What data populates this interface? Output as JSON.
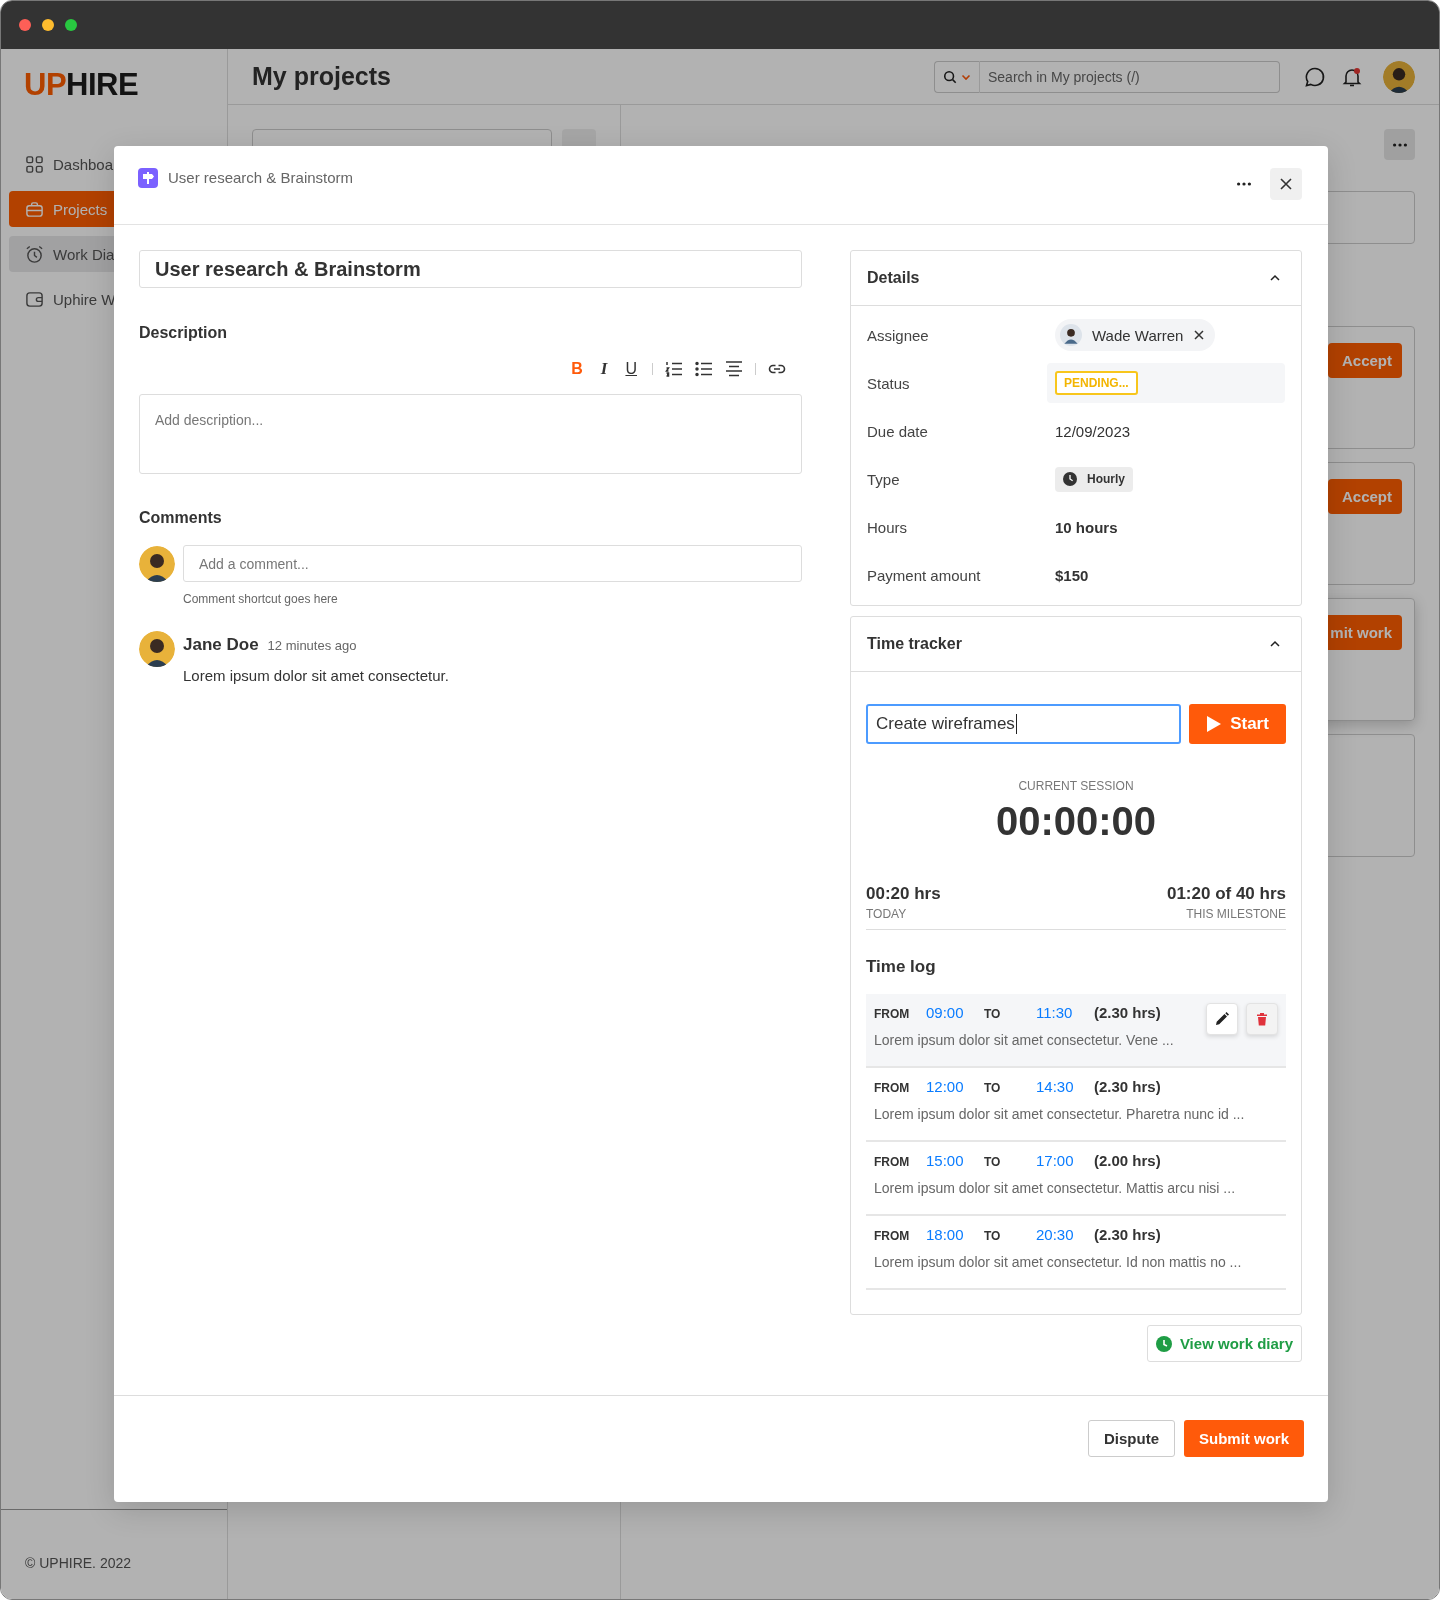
{
  "sidebar": {
    "logo": {
      "accent": "UP",
      "rest": "HIRE"
    },
    "items": [
      {
        "kind": "grid",
        "label": "Dashboa",
        "selected": false,
        "hovered": false
      },
      {
        "kind": "briefcase",
        "label": "Projects",
        "selected": true,
        "hovered": false
      },
      {
        "kind": "alarm",
        "label": "Work Dia",
        "selected": false,
        "hovered": true
      },
      {
        "kind": "wallet",
        "label": "Uphire W",
        "selected": false,
        "hovered": false
      }
    ],
    "footer": "© UPHIRE. 2022"
  },
  "header": {
    "title": "My projects",
    "search": {
      "placeholder": "Search in My projects (/)"
    },
    "notifications_unread": true
  },
  "background": {
    "card_buttons": [
      "Accept",
      "Accept",
      "mit work"
    ]
  },
  "modal": {
    "breadcrumb": "User research & Brainstorm",
    "title": "User research & Brainstorm",
    "description": {
      "label": "Description",
      "placeholder": "Add description...",
      "toolbar": [
        [
          {
            "kind": "bold",
            "label": "B",
            "active": true
          },
          {
            "kind": "italic",
            "label": "I",
            "active": false
          },
          {
            "kind": "underline",
            "label": "U",
            "active": false
          }
        ],
        [
          {
            "kind": "ordered-list",
            "active": false
          },
          {
            "kind": "bullet-list",
            "active": false
          },
          {
            "kind": "align-center",
            "active": false
          }
        ],
        [
          {
            "kind": "link",
            "active": false
          }
        ]
      ]
    },
    "comments": {
      "label": "Comments",
      "placeholder": "Add a comment...",
      "hint": "Comment shortcut goes here",
      "items": [
        {
          "author": "Jane Doe",
          "time": "12 minutes ago",
          "text": "Lorem ipsum dolor sit amet consectetur."
        }
      ]
    },
    "details": {
      "title": "Details",
      "expanded": true,
      "rows": [
        {
          "kind": "assignee",
          "label": "Assignee",
          "value": "Wade Warren"
        },
        {
          "kind": "status",
          "label": "Status",
          "value": "PENDING..."
        },
        {
          "kind": "text",
          "label": "Due date",
          "value": "12/09/2023"
        },
        {
          "kind": "type",
          "label": "Type",
          "value": "Hourly"
        },
        {
          "kind": "strong",
          "label": "Hours",
          "value": "10 hours"
        },
        {
          "kind": "strong",
          "label": "Payment amount",
          "value": "$150"
        }
      ]
    },
    "time_tracker": {
      "title": "Time tracker",
      "expanded": true,
      "task": {
        "value": "Create wireframes",
        "focused": true
      },
      "start_label": "Start",
      "session_label": "CURRENT SESSION",
      "session_time": "00:00:00",
      "stats": [
        {
          "value": "00:20 hrs",
          "label": "TODAY"
        },
        {
          "value": "01:20 of 40 hrs",
          "label": "THIS MILESTONE"
        }
      ],
      "log_title": "Time log",
      "log": [
        {
          "from_label": "FROM",
          "from": "09:00",
          "to_label": "TO",
          "to": "11:30",
          "duration": "(2.30 hrs)",
          "note": "Lorem ipsum dolor sit amet consectetur. Vene ...",
          "hovered": true
        },
        {
          "from_label": "FROM",
          "from": "12:00",
          "to_label": "TO",
          "to": "14:30",
          "duration": "(2.30 hrs)",
          "note": "Lorem ipsum dolor sit amet consectetur. Pharetra nunc id ...",
          "hovered": false
        },
        {
          "from_label": "FROM",
          "from": "15:00",
          "to_label": "TO",
          "to": "17:00",
          "duration": "(2.00 hrs)",
          "note": "Lorem ipsum dolor sit amet consectetur. Mattis arcu nisi ...",
          "hovered": false
        },
        {
          "from_label": "FROM",
          "from": "18:00",
          "to_label": "TO",
          "to": "20:30",
          "duration": "(2.30 hrs)",
          "note": "Lorem ipsum dolor sit amet consectetur. Id non mattis no ...",
          "hovered": false
        }
      ]
    },
    "diary_link": "View work diary",
    "footer_buttons": [
      {
        "kind": "secondary",
        "label": "Dispute"
      },
      {
        "kind": "primary",
        "label": "Submit work"
      }
    ]
  }
}
